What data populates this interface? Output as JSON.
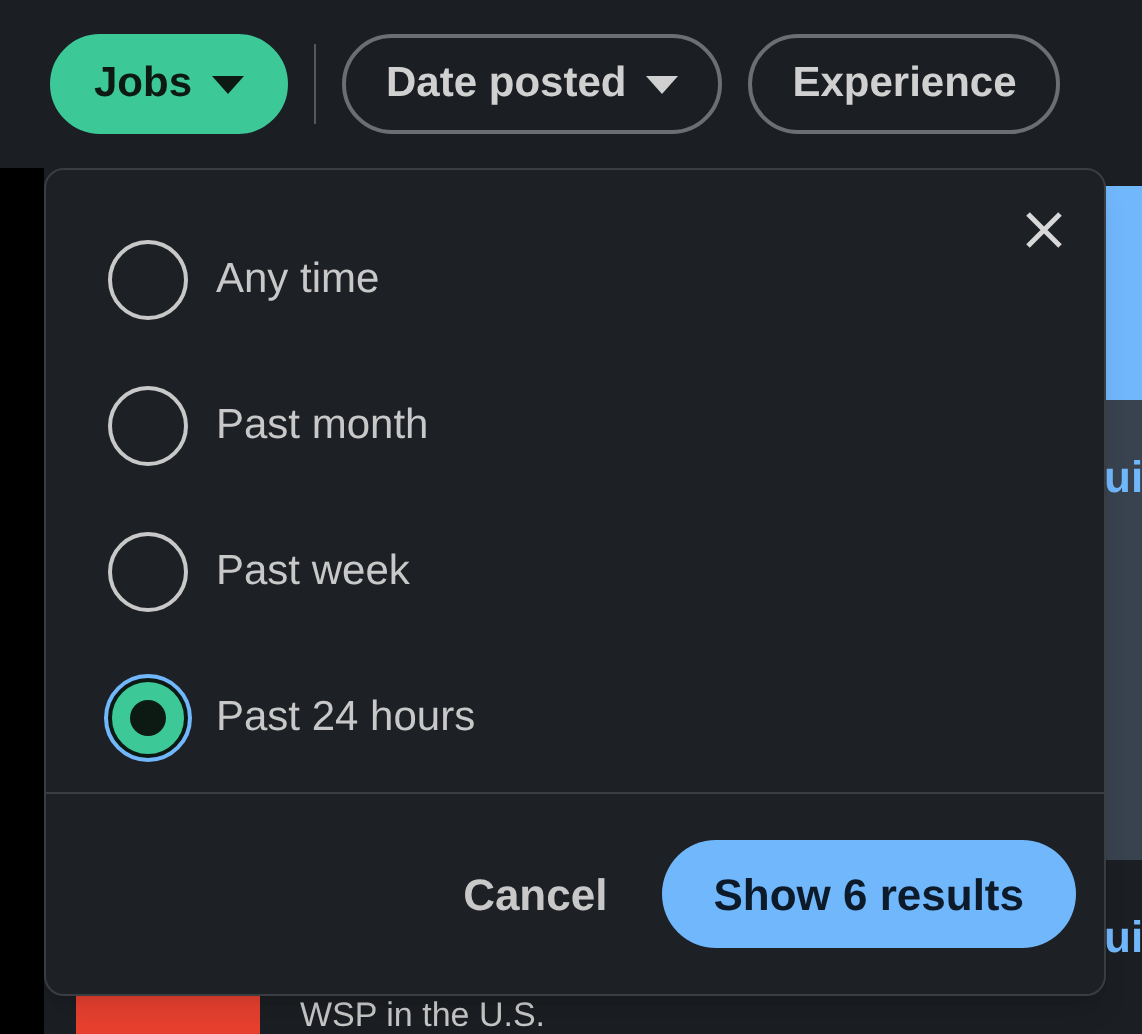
{
  "filters": [
    {
      "label": "Jobs",
      "selected": true,
      "caret": true
    },
    {
      "label": "Date posted",
      "selected": false,
      "caret": true
    },
    {
      "label": "Experience",
      "selected": false,
      "caret": false
    }
  ],
  "background": {
    "snippets": [
      "ui",
      "ui"
    ],
    "company_text": "WSP in the U.S."
  },
  "popup": {
    "options": [
      {
        "label": "Any time",
        "selected": false
      },
      {
        "label": "Past month",
        "selected": false
      },
      {
        "label": "Past week",
        "selected": false
      },
      {
        "label": "Past 24 hours",
        "selected": true
      }
    ],
    "cancel": "Cancel",
    "apply": "Show 6 results"
  }
}
